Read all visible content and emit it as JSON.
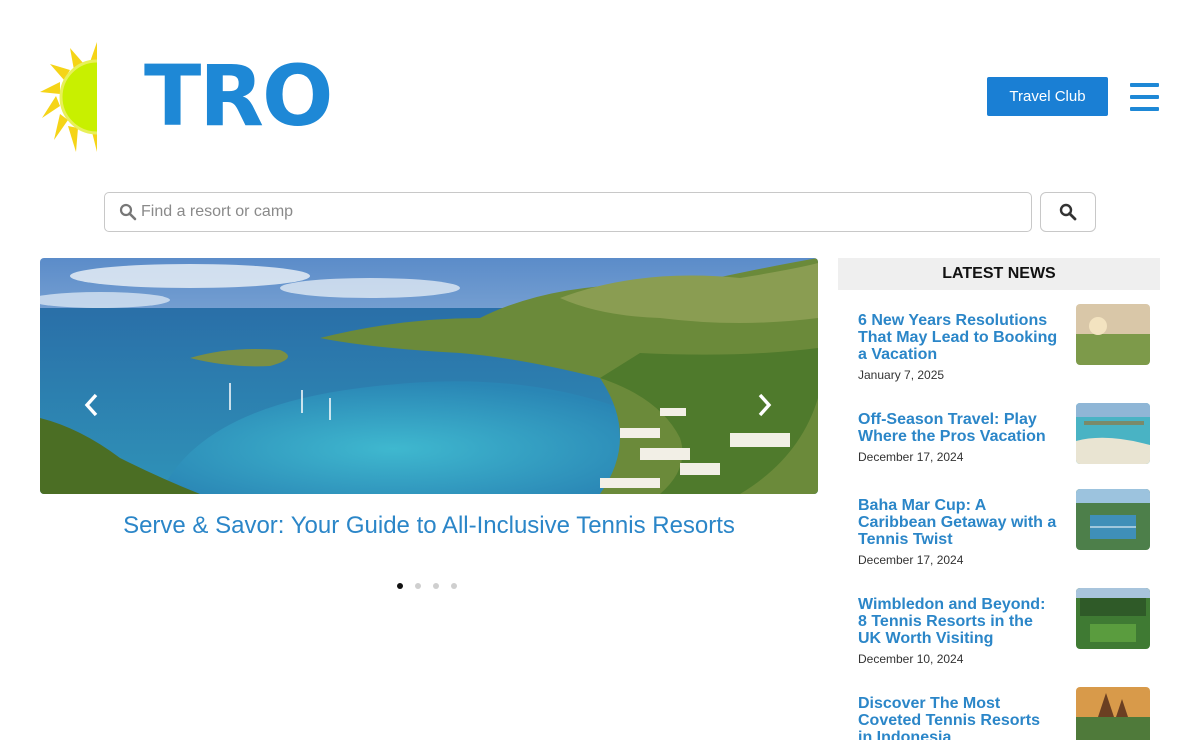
{
  "header": {
    "logo_text": "TRO",
    "travel_club_label": "Travel Club",
    "menu_icon": "hamburger-menu-icon"
  },
  "search": {
    "placeholder": "Find a resort or camp",
    "value": "",
    "submit_icon": "search-icon"
  },
  "slider": {
    "slide_title": "Serve & Savor: Your Guide to All-Inclusive Tennis Resorts",
    "slide_count": 4,
    "active_index": 0
  },
  "news": {
    "heading": "LATEST NEWS",
    "items": [
      {
        "title": "6 New Years Resolutions That May Lead to Booking a Vacation",
        "date": "January 7, 2025"
      },
      {
        "title": "Off-Season Travel: Play Where the Pros Vacation",
        "date": "December 17, 2024"
      },
      {
        "title": "Baha Mar Cup: A Caribbean Getaway with a Tennis Twist",
        "date": "December 17, 2024"
      },
      {
        "title": "Wimbledon and Beyond: 8 Tennis Resorts in the UK Worth Visiting",
        "date": "December 10, 2024"
      },
      {
        "title": "Discover The Most Coveted Tennis Resorts in Indonesia",
        "date": ""
      }
    ]
  },
  "colors": {
    "brand_blue": "#1e88d6",
    "link_blue": "#2b86c8",
    "button_blue": "#1a7fd4",
    "sun_yellow": "#f5d417",
    "sun_green": "#c8f000"
  }
}
